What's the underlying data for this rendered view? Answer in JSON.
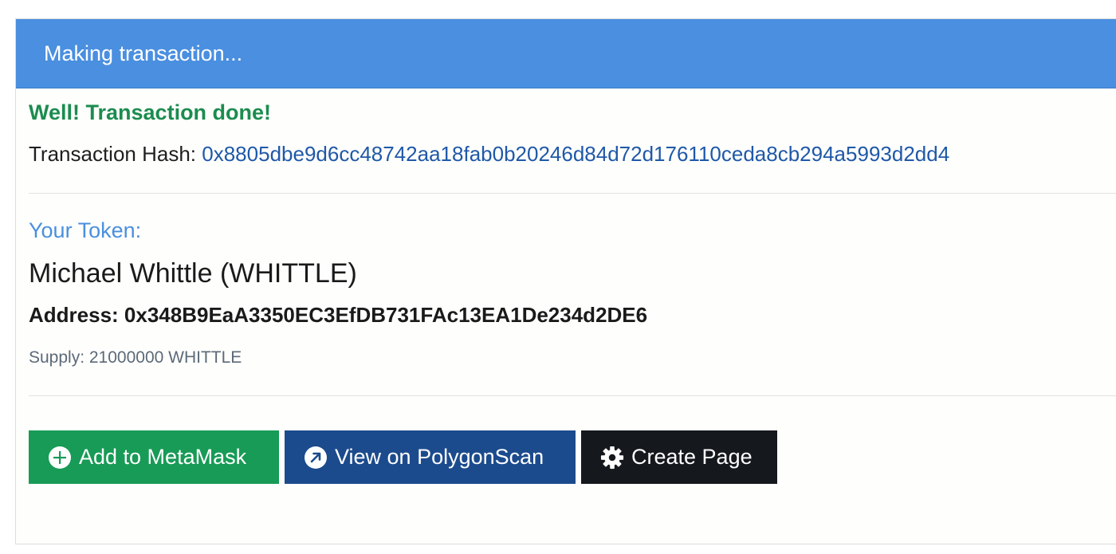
{
  "header": {
    "title": "Making transaction..."
  },
  "transaction": {
    "status": "Well! Transaction done!",
    "hash_label": "Transaction Hash:",
    "hash_value": "0x8805dbe9d6cc48742aa18fab0b20246d84d72d176110ceda8cb294a5993d2dd4"
  },
  "token": {
    "heading": "Your Token:",
    "name": "Michael Whittle (WHITTLE)",
    "address": "Address: 0x348B9EaA3350EC3EfDB731FAc13EA1De234d2DE6",
    "supply": "Supply: 21000000 WHITTLE"
  },
  "actions": {
    "metamask": {
      "label": "Add to MetaMask",
      "icon": "plus-circle-icon",
      "color": "#179b56"
    },
    "polygonscan": {
      "label": "View on PolygonScan",
      "icon": "external-link-icon",
      "color": "#1c4b8d"
    },
    "create_page": {
      "label": "Create Page",
      "icon": "gear-icon",
      "color": "#15181c"
    }
  },
  "colors": {
    "header_bg": "#4a8fe0",
    "success": "#1b8c4f",
    "link": "#1f58a8",
    "accent": "#4a8fe0"
  }
}
